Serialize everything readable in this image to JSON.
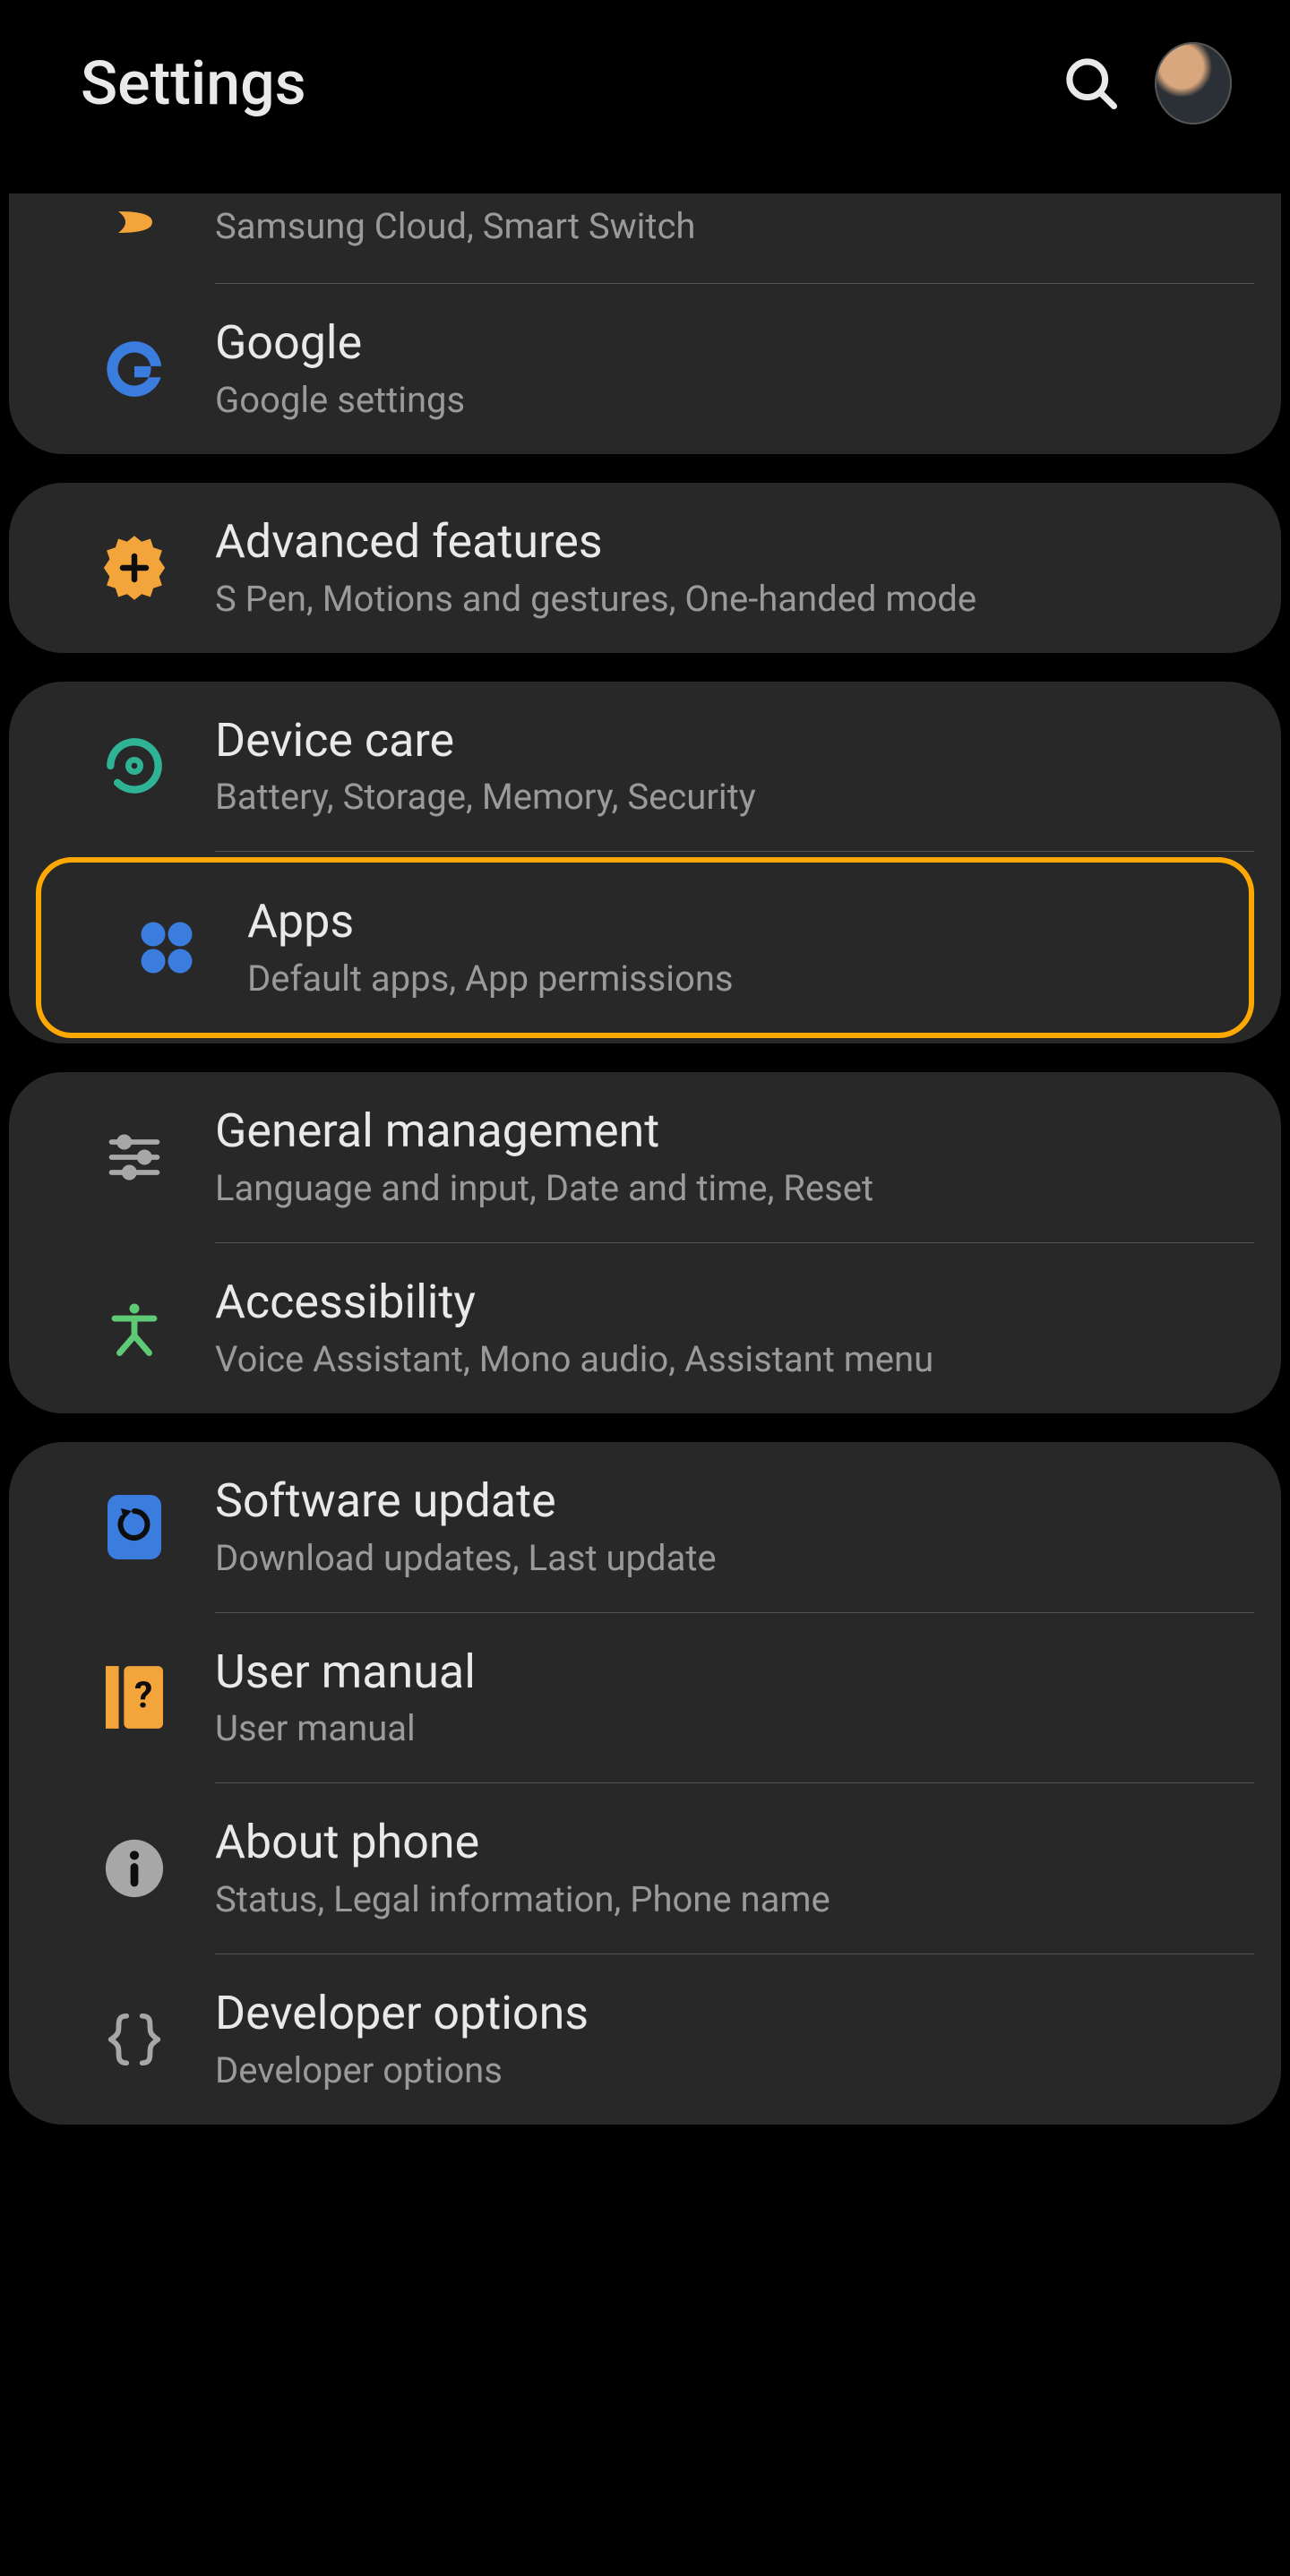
{
  "header": {
    "title": "Settings"
  },
  "sections": [
    {
      "cutTop": true,
      "items": [
        {
          "id": "accounts-item",
          "title": "",
          "sub": "Samsung Cloud, Smart Switch",
          "icon": "samsung-icon",
          "partial": true
        },
        {
          "id": "google-item",
          "title": "Google",
          "sub": "Google settings",
          "icon": "google-g-icon"
        }
      ]
    },
    {
      "items": [
        {
          "id": "advanced-features-item",
          "title": "Advanced features",
          "sub": "S Pen, Motions and gestures, One-handed mode",
          "icon": "gear-plus-icon"
        }
      ]
    },
    {
      "items": [
        {
          "id": "device-care-item",
          "title": "Device care",
          "sub": "Battery, Storage, Memory, Security",
          "icon": "device-care-icon"
        },
        {
          "id": "apps-item",
          "title": "Apps",
          "sub": "Default apps, App permissions",
          "icon": "apps-grid-icon",
          "highlighted": true
        }
      ]
    },
    {
      "items": [
        {
          "id": "general-management-item",
          "title": "General management",
          "sub": "Language and input, Date and time, Reset",
          "icon": "sliders-icon"
        },
        {
          "id": "accessibility-item",
          "title": "Accessibility",
          "sub": "Voice Assistant, Mono audio, Assistant menu",
          "icon": "person-icon"
        }
      ]
    },
    {
      "items": [
        {
          "id": "software-update-item",
          "title": "Software update",
          "sub": "Download updates, Last update",
          "icon": "update-icon"
        },
        {
          "id": "user-manual-item",
          "title": "User manual",
          "sub": "User manual",
          "icon": "manual-icon"
        },
        {
          "id": "about-phone-item",
          "title": "About phone",
          "sub": "Status, Legal information, Phone name",
          "icon": "info-icon"
        },
        {
          "id": "developer-options-item",
          "title": "Developer options",
          "sub": "Developer options",
          "icon": "braces-icon"
        }
      ]
    }
  ],
  "colors": {
    "highlight": "#ffa900",
    "blue": "#3a7dde",
    "teal": "#2eb395",
    "green": "#5fca76",
    "orange": "#f3a53b",
    "grey": "#a7a7a7"
  }
}
